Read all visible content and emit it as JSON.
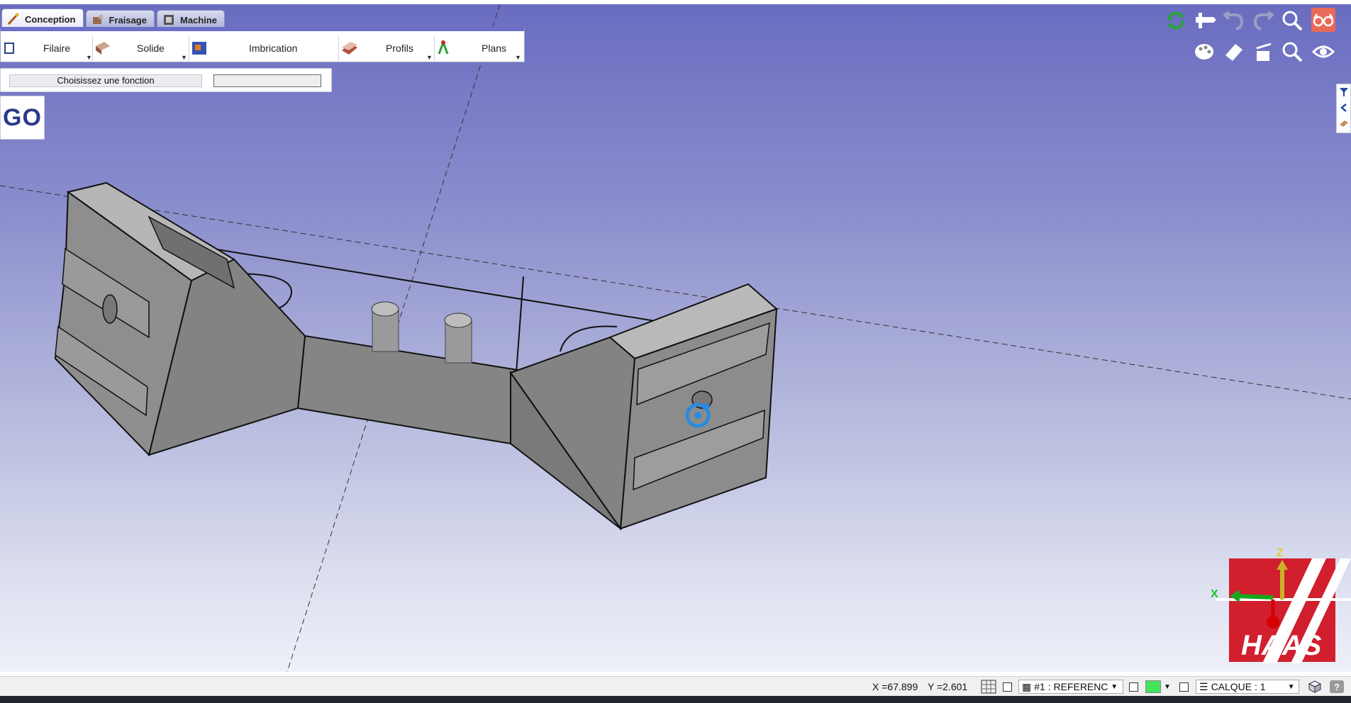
{
  "tabs": [
    {
      "label": "Conception",
      "icon": "design-wand-icon",
      "active": true
    },
    {
      "label": "Fraisage",
      "icon": "milling-hand-icon",
      "active": false
    },
    {
      "label": "Machine",
      "icon": "machine-icon",
      "active": false
    }
  ],
  "ribbon": {
    "items": [
      {
        "label": "Filaire",
        "icon": "wireframe-icon"
      },
      {
        "label": "Solide",
        "icon": "solid-icon"
      },
      {
        "label": "Imbrication",
        "icon": "nesting-icon"
      },
      {
        "label": "Profils",
        "icon": "profiles-icon"
      },
      {
        "label": "Plans",
        "icon": "planes-icon"
      }
    ]
  },
  "function_bar": {
    "label": "Choisissez une fonction",
    "value": ""
  },
  "go_label": "GO",
  "top_right_toolbar": [
    "refresh-icon",
    "measure-icon",
    "undo-icon",
    "redo-icon",
    "zoom-icon",
    "glasses-icon",
    "color-palette-icon",
    "eraser-icon",
    "clear-icon",
    "zoom-fit-icon",
    "view-eye-icon"
  ],
  "side_tabs": [
    "filter-icon",
    "collapse-icon",
    "material-icon"
  ],
  "axis_labels": {
    "x": "X",
    "z": "Z"
  },
  "logo_text": "HAAS",
  "status": {
    "x_coord": "X =67.899",
    "y_coord": "Y =2.601",
    "reference": "#1 : REFERENC",
    "layer": "CALQUE : 1",
    "accent_color": "#44e35a"
  }
}
